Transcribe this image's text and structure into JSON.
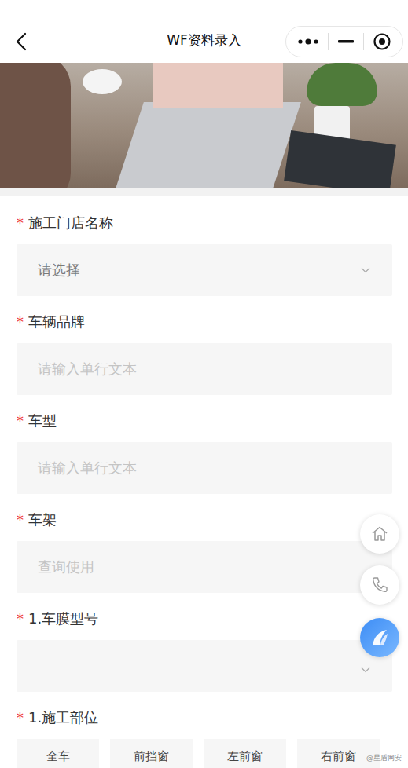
{
  "nav": {
    "title": "WF资料录入"
  },
  "fields": [
    {
      "label": "施工门店名称",
      "required": true,
      "kind": "select",
      "placeholder": "请选择"
    },
    {
      "label": "车辆品牌",
      "required": true,
      "kind": "input",
      "placeholder": "请输入单行文本"
    },
    {
      "label": "车型",
      "required": true,
      "kind": "input",
      "placeholder": "请输入单行文本"
    },
    {
      "label": "车架",
      "required": true,
      "kind": "input",
      "placeholder": "查询使用"
    },
    {
      "label": "1.车膜型号",
      "required": true,
      "kind": "select-empty",
      "placeholder": ""
    }
  ],
  "part_field": {
    "label": "1.施工部位",
    "required": true,
    "options": [
      {
        "label": "全车",
        "selected": false
      },
      {
        "label": "前挡窗",
        "selected": false
      },
      {
        "label": "左前窗",
        "selected": false
      },
      {
        "label": "右前窗",
        "selected": false
      }
    ]
  },
  "required_mark": "*",
  "watermark": "@星盾网安"
}
